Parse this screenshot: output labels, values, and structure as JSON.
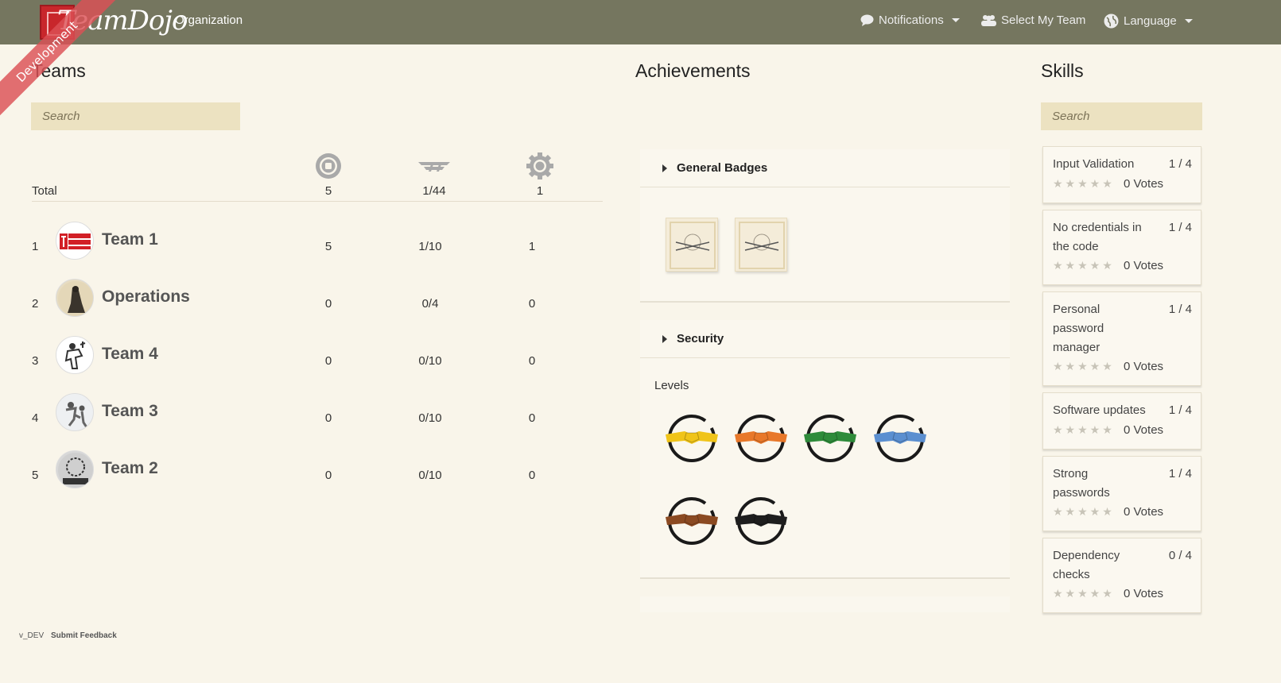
{
  "header": {
    "brand": "TeamDojo",
    "nav_organization": "Organization",
    "nav_notifications": "Notifications",
    "nav_select_team": "Select My Team",
    "nav_language": "Language",
    "ribbon": "Development"
  },
  "teams": {
    "title": "Teams",
    "search_placeholder": "Search",
    "total_label": "Total",
    "totals": [
      "5",
      "1/44",
      "1"
    ],
    "rows": [
      {
        "rank": "1",
        "name": "Team 1",
        "v1": "5",
        "v2": "1/10",
        "v3": "1"
      },
      {
        "rank": "2",
        "name": "Operations",
        "v1": "0",
        "v2": "0/4",
        "v3": "0"
      },
      {
        "rank": "3",
        "name": "Team 4",
        "v1": "0",
        "v2": "0/10",
        "v3": "0"
      },
      {
        "rank": "4",
        "name": "Team 3",
        "v1": "0",
        "v2": "0/10",
        "v3": "0"
      },
      {
        "rank": "5",
        "name": "Team 2",
        "v1": "0",
        "v2": "0/10",
        "v3": "0"
      }
    ]
  },
  "achievements": {
    "title": "Achievements",
    "general_badges": "General Badges",
    "security": "Security",
    "levels_label": "Levels",
    "belt_colors": [
      "#f0c419",
      "#e8782a",
      "#2e8b3a",
      "#5b8fd0",
      "#8b4a22",
      "#1e1e1e"
    ]
  },
  "skills": {
    "title": "Skills",
    "search_placeholder": "Search",
    "items": [
      {
        "name": "Input Validation",
        "count": "1 / 4",
        "votes": "0 Votes"
      },
      {
        "name": "No credentials in the code",
        "count": "1 / 4",
        "votes": "0 Votes"
      },
      {
        "name": "Personal password manager",
        "count": "1 / 4",
        "votes": "0 Votes"
      },
      {
        "name": "Software updates",
        "count": "1 / 4",
        "votes": "0 Votes"
      },
      {
        "name": "Strong passwords",
        "count": "1 / 4",
        "votes": "0 Votes"
      },
      {
        "name": "Dependency checks",
        "count": "0 / 4",
        "votes": "0 Votes"
      }
    ],
    "stars": "★★★★★"
  },
  "footer": {
    "version": "v_DEV",
    "feedback": "Submit Feedback"
  }
}
